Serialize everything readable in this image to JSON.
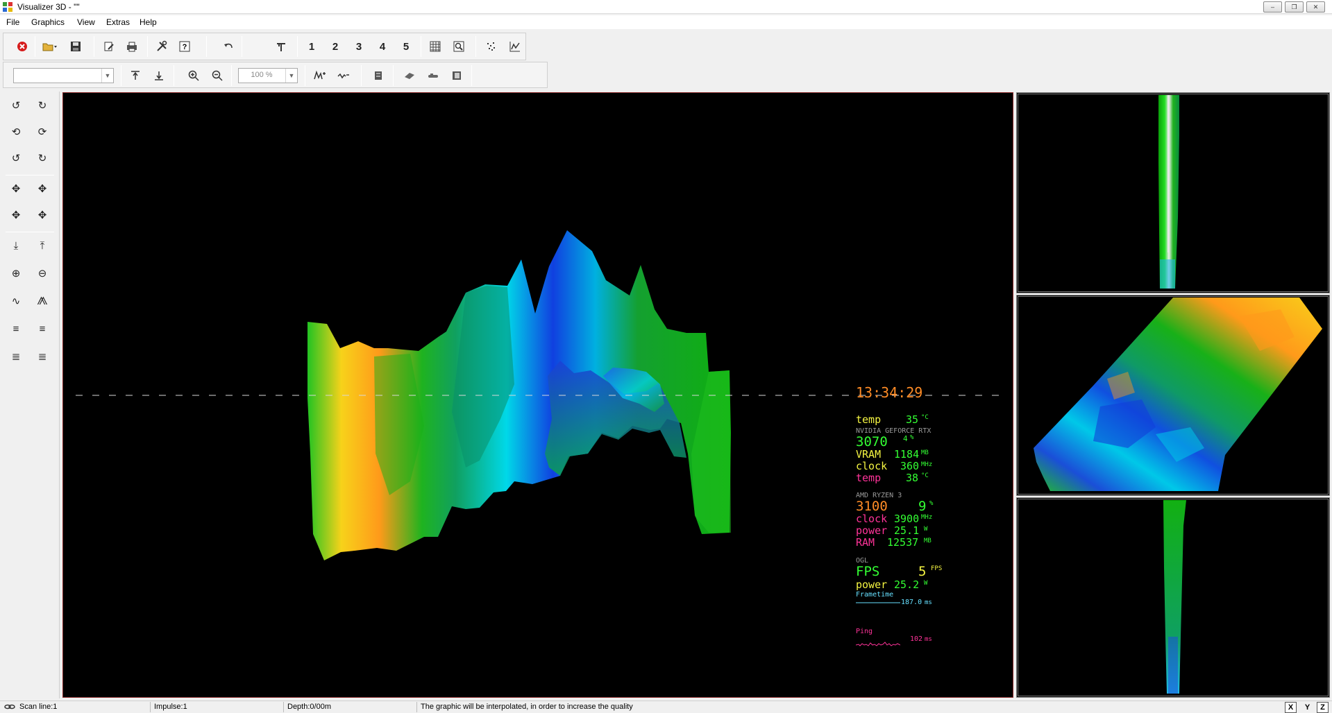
{
  "window": {
    "title": "Visualizer 3D - \"\"",
    "controls": [
      "minimize",
      "restore",
      "close"
    ]
  },
  "menu": [
    "File",
    "Graphics",
    "View",
    "Extras",
    "Help"
  ],
  "toolbar1": {
    "numbers": [
      "1",
      "2",
      "3",
      "4",
      "5"
    ],
    "icons": [
      "close-red-icon",
      "open-folder-icon",
      "save-icon",
      "edit-icon",
      "print-icon",
      "tools-icon",
      "help-icon",
      "undo-icon",
      "antenna-icon",
      "grid-icon",
      "zoom-window-icon",
      "scatter-icon",
      "curve-icon"
    ]
  },
  "toolbar2": {
    "combo_value": "",
    "zoom_value": "100 %",
    "icons": [
      "depth-up-icon",
      "depth-down-icon",
      "zoom-in-icon",
      "zoom-out-icon",
      "marker-add-icon",
      "marker-remove-icon",
      "layer-icon",
      "probe-icon",
      "pipe-icon",
      "frame-icon"
    ]
  },
  "left_tools": [
    "rotate-x-ccw",
    "rotate-x-cw",
    "rotate-y-ccw",
    "rotate-y-cw",
    "rotate-z-ccw",
    "rotate-z-cw",
    "move-left",
    "move-right",
    "move-up",
    "move-down",
    "depth-bottom",
    "depth-top",
    "zoom-in",
    "zoom-out",
    "marker-minus",
    "marker-plus",
    "align-left-1",
    "align-right-1",
    "align-left-2",
    "align-right-2"
  ],
  "hud": {
    "time": "13:34:29",
    "gpu_temp_label": "temp",
    "gpu_temp_value": "35",
    "gpu_temp_unit": "°C",
    "gpu_name": "NVIDIA GEFORCE RTX",
    "gpu_model": "3070",
    "gpu_load": "4",
    "gpu_load_unit": "%",
    "vram_label": "VRAM",
    "vram_value": "1184",
    "vram_unit": "MB",
    "gpu_clock_label": "clock",
    "gpu_clock_value": "360",
    "gpu_clock_unit": "MHz",
    "gpu_temp2_label": "temp",
    "gpu_temp2_value": "38",
    "gpu_temp2_unit": "°C",
    "cpu_name": "AMD RYZEN 3",
    "cpu_model": "3100",
    "cpu_load": "9",
    "cpu_load_unit": "%",
    "cpu_clock_label": "clock",
    "cpu_clock_value": "3900",
    "cpu_clock_unit": "MHz",
    "cpu_power_label": "power",
    "cpu_power_value": "25.1",
    "cpu_power_unit": "W",
    "ram_label": "RAM",
    "ram_value": "12537",
    "ram_unit": "MB",
    "api": "OGL",
    "fps_label": "FPS",
    "fps_value": "5",
    "fps_unit": "FPS",
    "power_label": "power",
    "power_value": "25.2",
    "power_unit": "W",
    "frametime_label": "Frametime",
    "frametime_value": "187.0",
    "frametime_unit": "ms",
    "ping_label": "Ping",
    "ping_value": "102",
    "ping_unit": "ms"
  },
  "status": {
    "scan_line": "Scan line:1",
    "impulse": "Impulse:1",
    "depth": "Depth:0/00m",
    "message": "The graphic will be interpolated, in order to increase the quality",
    "axes": [
      "X",
      "Y",
      "Z"
    ]
  },
  "colors": {
    "clock": "#ff8c26",
    "hud_green": "#33ff33",
    "hud_yellow": "#f5f542",
    "hud_pink": "#ff3399",
    "hud_orange": "#ff8c26",
    "hud_cyan": "#66e0ff",
    "view_border": "#8b2a2a"
  }
}
